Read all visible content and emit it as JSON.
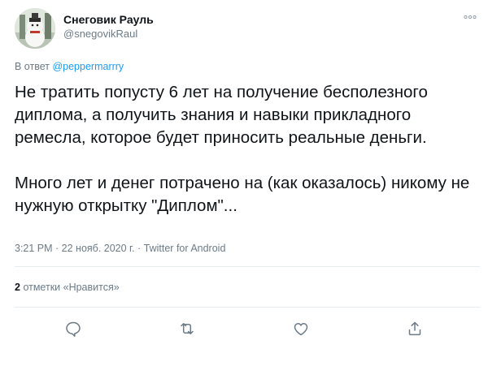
{
  "author": {
    "display_name": "Снеговик Рауль",
    "handle": "@snegovikRaul"
  },
  "more_icon": "more-dots-icon",
  "reply": {
    "prefix": "В ответ",
    "mention": "@peppermarrry"
  },
  "tweet": {
    "paragraph_1": "Не тратить попусту 6 лет на получение бесполезного диплома, а получить знания и навыки прикладного ремесла, которое будет приносить реальные деньги.",
    "paragraph_2": "Много лет и денег потрачено на (как оказалось) никому не нужную открытку \"Диплом\"..."
  },
  "meta": {
    "timestamp": "3:21 PM · 22 нояб. 2020 г. · Twitter for Android"
  },
  "likes": {
    "count": "2",
    "label": "отметки «Нравится»"
  },
  "actions": [
    {
      "name": "reply",
      "icon": "comment-icon"
    },
    {
      "name": "retweet",
      "icon": "retweet-icon"
    },
    {
      "name": "like",
      "icon": "heart-icon"
    },
    {
      "name": "share",
      "icon": "share-icon"
    }
  ],
  "colors": {
    "link": "#1d9bf0",
    "secondary_text": "#6b7a87",
    "divider": "#e6ecf0",
    "icon": "#6b7a87"
  }
}
